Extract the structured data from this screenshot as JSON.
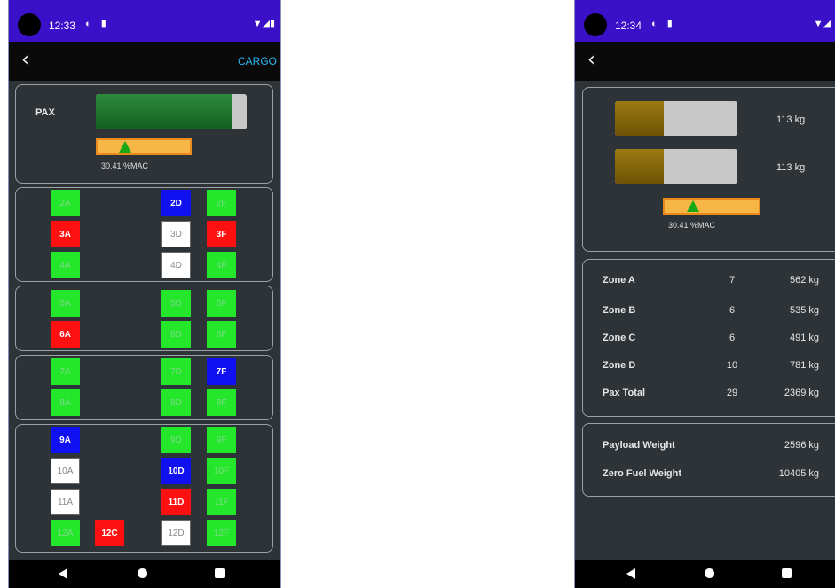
{
  "phone1": {
    "status": {
      "time": "12:33",
      "icons": "◐ ▮",
      "right": "▼◢▮"
    },
    "toolbar": {
      "back": "‹",
      "action": "CARGO"
    },
    "pax_label": "PAX",
    "pax_bar_fill": 0.9,
    "mac_label": "30.41 %MAC",
    "mac_marker": 0.3,
    "seats": [
      [
        "2A",
        "green"
      ],
      [
        "2D",
        "blue"
      ],
      [
        "2F",
        "green"
      ],
      [
        "3A",
        "red"
      ],
      [
        "3D",
        "white"
      ],
      [
        "3F",
        "red"
      ],
      [
        "4A",
        "green"
      ],
      [
        "4D",
        "white"
      ],
      [
        "4F",
        "green"
      ],
      [
        "5A",
        "green"
      ],
      [
        "5D",
        "green"
      ],
      [
        "5F",
        "green"
      ],
      [
        "6A",
        "red"
      ],
      [
        "6D",
        "green"
      ],
      [
        "6F",
        "green"
      ],
      [
        "7A",
        "green"
      ],
      [
        "7D",
        "green"
      ],
      [
        "7F",
        "blue"
      ],
      [
        "8A",
        "green"
      ],
      [
        "8D",
        "green"
      ],
      [
        "8F",
        "green"
      ],
      [
        "9A",
        "blue"
      ],
      [
        "9D",
        "green"
      ],
      [
        "9F",
        "green"
      ],
      [
        "10A",
        "white"
      ],
      [
        "10D",
        "blue"
      ],
      [
        "10F",
        "green"
      ],
      [
        "11A",
        "white"
      ],
      [
        "11D",
        "red"
      ],
      [
        "11F",
        "green"
      ],
      [
        "12A",
        "green"
      ],
      [
        "12C",
        "red"
      ],
      [
        "12D",
        "white"
      ],
      [
        "12F",
        "green"
      ]
    ]
  },
  "phone2": {
    "status": {
      "time": "12:34",
      "icons": "◐ ▮",
      "right": "▼◢"
    },
    "toolbar": {
      "back": "‹"
    },
    "bar1_fill": 0.4,
    "bar1_value": "113 kg",
    "bar2_fill": 0.4,
    "bar2_value": "113 kg",
    "mac_label": "30.41 %MAC",
    "mac_marker": 0.3,
    "zones": [
      {
        "name": "Zone A",
        "count": "7",
        "kg": "562 kg"
      },
      {
        "name": "Zone B",
        "count": "6",
        "kg": "535 kg"
      },
      {
        "name": "Zone C",
        "count": "6",
        "kg": "491 kg"
      },
      {
        "name": "Zone D",
        "count": "10",
        "kg": "781 kg"
      },
      {
        "name": "Pax Total",
        "count": "29",
        "kg": "2369 kg"
      }
    ],
    "weights": [
      {
        "name": "Payload Weight",
        "kg": "2596 kg"
      },
      {
        "name": "Zero Fuel Weight",
        "kg": "10405 kg"
      }
    ]
  },
  "colors": {
    "status_bar": "#3a10c8",
    "panel_bg": "#2e3337",
    "seat_green": "#24e62b",
    "seat_red": "#ff1010",
    "seat_blue": "#1010f0",
    "mac_bar": "#f7b646",
    "pax_fill": "#1a7a2c",
    "cargo_fill": "#8a6a08",
    "cargo_link": "#29b6f6"
  }
}
